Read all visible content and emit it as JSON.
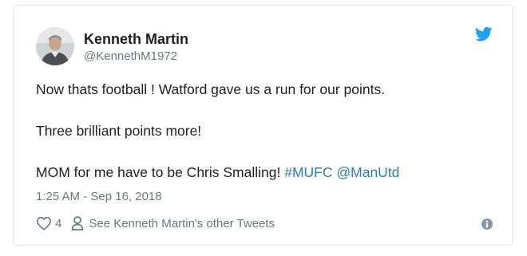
{
  "tweet": {
    "author_name": "Kenneth Martin",
    "author_handle": "@KennethM1972",
    "line1": "Now thats football ! Watford gave us a run for our points.",
    "line2": "Three brilliant points more!",
    "line3_text": "MOM for me have to be Chris Smalling! ",
    "hashtag": "#MUFC",
    "mention": "@ManUtd",
    "timestamp": "1:25 AM - Sep 16, 2018",
    "like_count": "4",
    "other_tweets_link": "See Kenneth Martin's other Tweets"
  },
  "icons": {
    "brand": "twitter-bird-icon",
    "like": "heart-icon",
    "profile": "person-icon",
    "info": "info-icon"
  },
  "colors": {
    "link": "#2b7bb9",
    "bird": "#1da1f2",
    "secondary_text": "#697882",
    "border": "#e1e8ed"
  }
}
